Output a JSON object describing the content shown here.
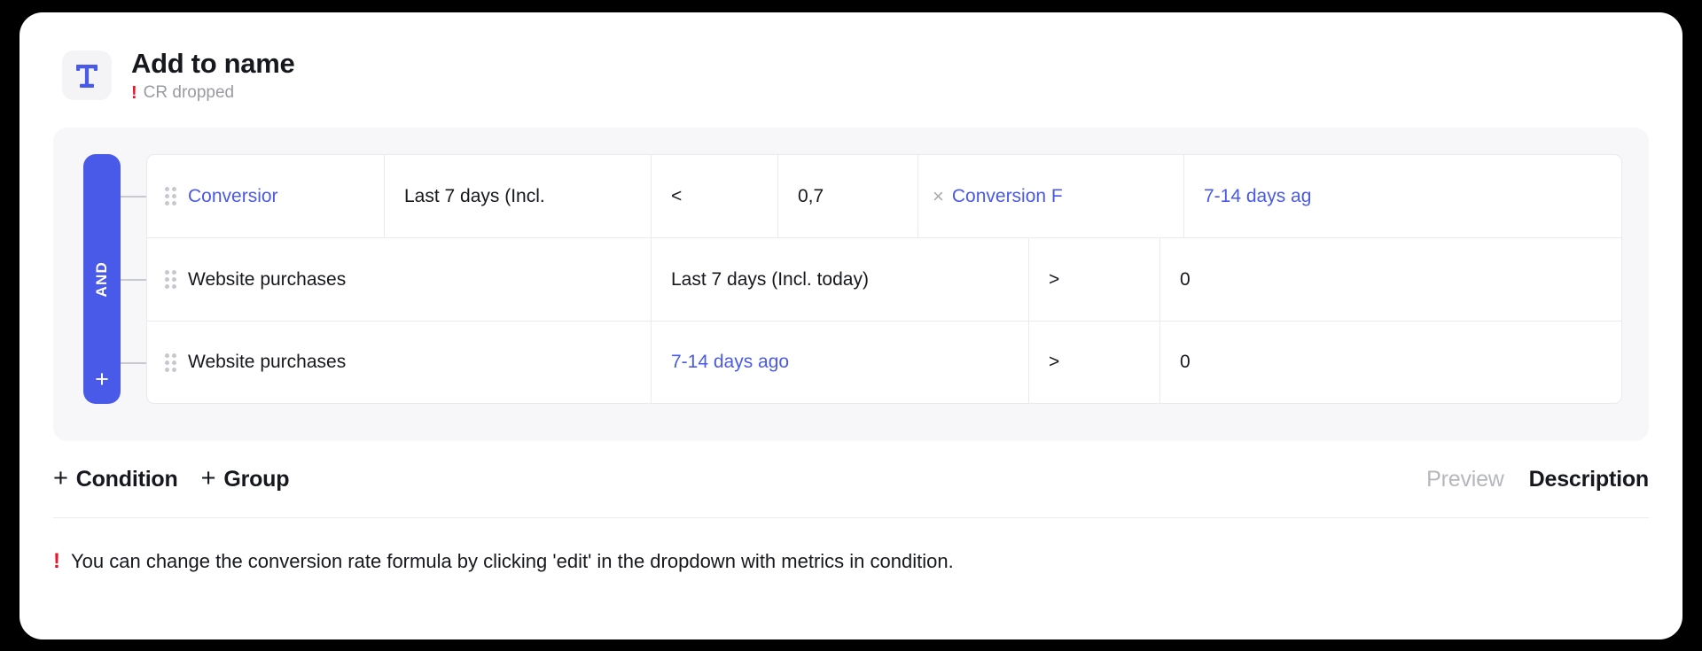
{
  "header": {
    "icon": "text-format-T-icon",
    "title": "Add to name",
    "warning_marker": "!",
    "subtitle": "CR dropped"
  },
  "group": {
    "operator_label": "AND",
    "add_icon": "plus-icon",
    "add_label": "+"
  },
  "conditions": [
    {
      "drag_handle": "drag-handle-icon",
      "metric": "Conversior",
      "period": "Last 7 days (Incl.",
      "operator": "<",
      "value": "0,7",
      "multiplier_symbol": "×",
      "second_metric": "Conversion F",
      "second_period": "7-14 days ag"
    },
    {
      "drag_handle": "drag-handle-icon",
      "metric": "Website purchases",
      "period": "Last 7 days (Incl. today)",
      "operator": ">",
      "value": "0"
    },
    {
      "drag_handle": "drag-handle-icon",
      "metric": "Website purchases",
      "period": "7-14 days ago",
      "operator": ">",
      "value": "0"
    }
  ],
  "toolbar": {
    "plus_symbol": "+",
    "add_condition_label": "Condition",
    "add_group_label": "Group",
    "preview_tab": "Preview",
    "description_tab": "Description"
  },
  "footer": {
    "warning_marker": "!",
    "message": "You can change the conversion rate formula by clicking 'edit' in the dropdown with metrics in condition."
  },
  "colors": {
    "accent_blue": "#4a5ae8",
    "warning_red": "#e8162b",
    "panel_bg": "#f7f7f9",
    "icon_bg": "#f4f4f6",
    "text_primary": "#16181d",
    "text_muted": "#9a9ba1"
  }
}
